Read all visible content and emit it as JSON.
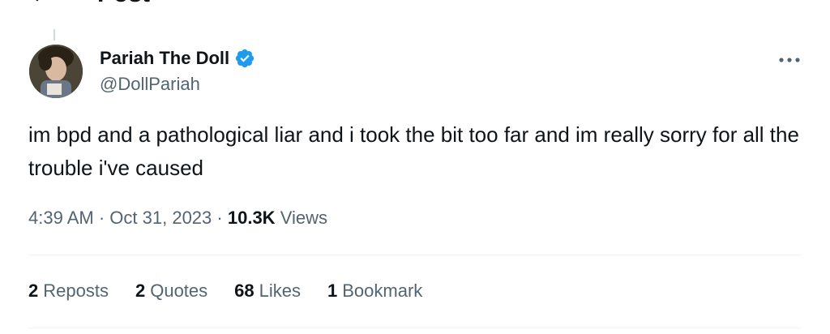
{
  "header": {
    "title": "Post"
  },
  "author": {
    "name": "Pariah The Doll",
    "handle": "@DollPariah",
    "verified_color": "#1d9bf0"
  },
  "tweet": {
    "text": "im bpd and a pathological liar and i took the bit too far and im really sorry for all the trouble i've caused",
    "time": "4:39 AM",
    "date": "Oct 31, 2023",
    "views_count": "10.3K",
    "views_label": "Views"
  },
  "stats": [
    {
      "count": "2",
      "label": "Reposts"
    },
    {
      "count": "2",
      "label": "Quotes"
    },
    {
      "count": "68",
      "label": "Likes"
    },
    {
      "count": "1",
      "label": "Bookmark"
    }
  ],
  "icons": {
    "back": "arrow-left-icon",
    "verified": "verified-badge-icon",
    "more": "more-horizontal-icon"
  }
}
